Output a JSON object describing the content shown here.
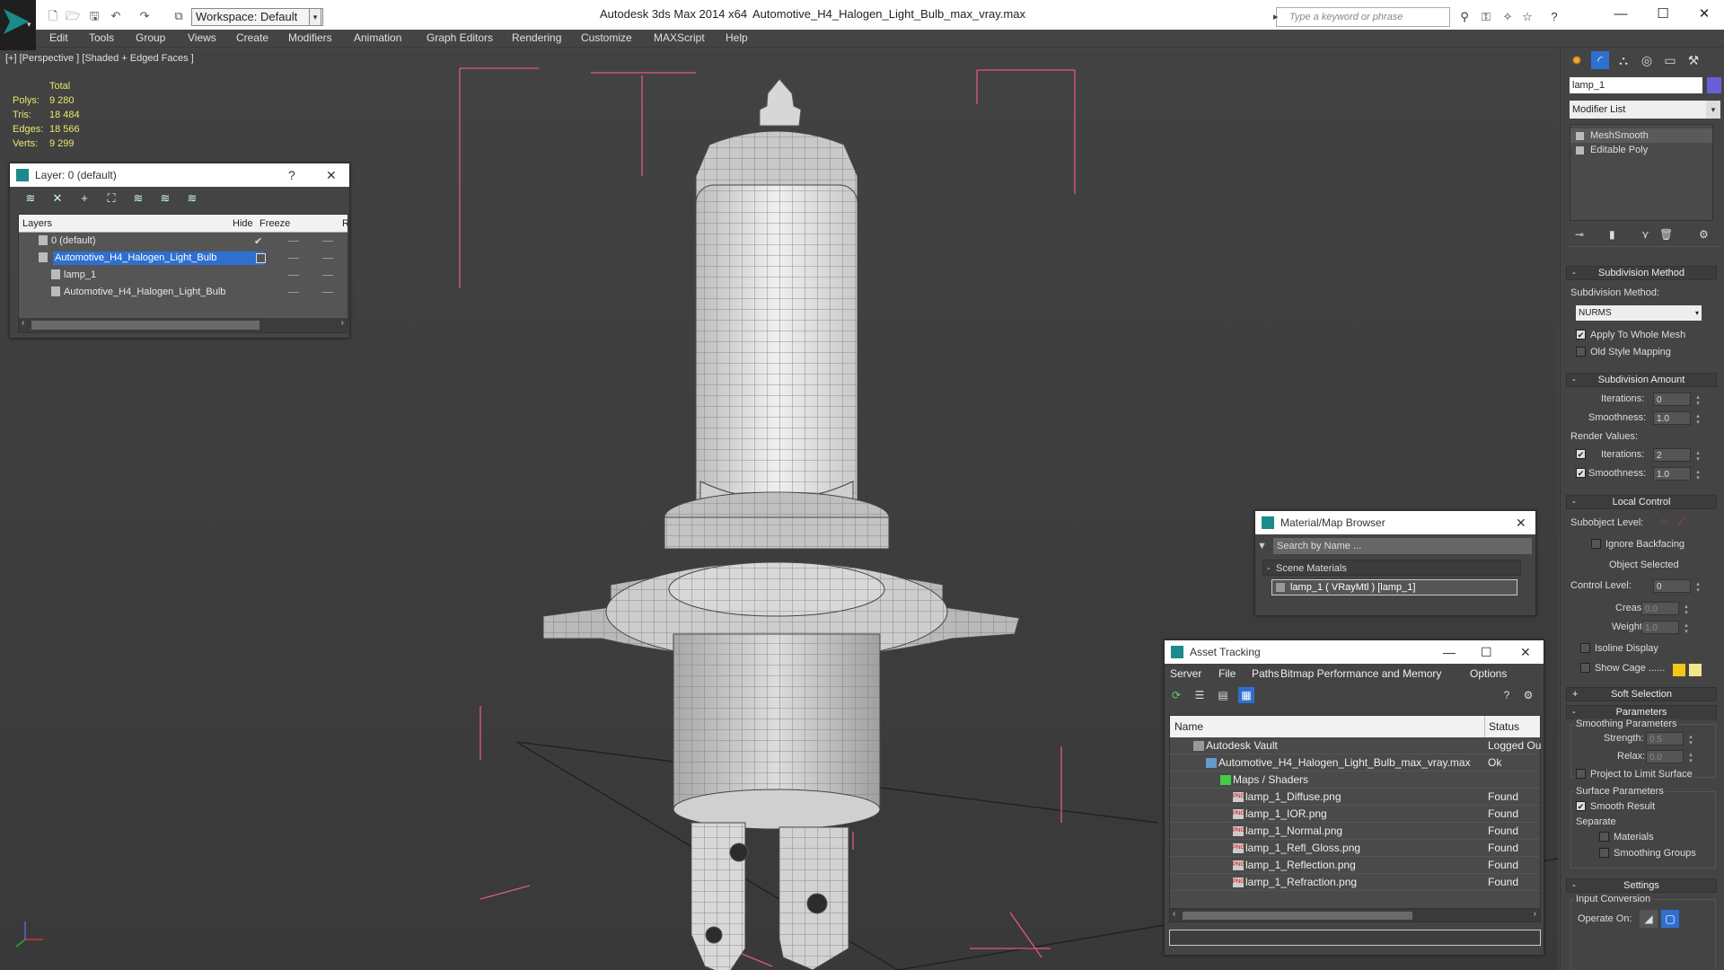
{
  "titlebar": {
    "workspace": "Workspace: Default",
    "app_title": "Autodesk 3ds Max  2014 x64",
    "file_title": "Automotive_H4_Halogen_Light_Bulb_max_vray.max",
    "search_placeholder": "Type a keyword or phrase"
  },
  "menu": [
    "Edit",
    "Tools",
    "Group",
    "Views",
    "Create",
    "Modifiers",
    "Animation",
    "Graph Editors",
    "Rendering",
    "Customize",
    "MAXScript",
    "Help"
  ],
  "viewport": {
    "label": "[+] [Perspective ] [Shaded + Edged Faces ]",
    "stats": {
      "header": "Total",
      "rows": [
        {
          "k": "Polys:",
          "v": "9 280"
        },
        {
          "k": "Tris:",
          "v": "18 484"
        },
        {
          "k": "Edges:",
          "v": "18 566"
        },
        {
          "k": "Verts:",
          "v": "9 299"
        }
      ]
    }
  },
  "layer_window": {
    "title": "Layer: 0 (default)",
    "help": "?",
    "close": "✕",
    "columns": {
      "layers": "Layers",
      "hide": "Hide",
      "freeze": "Freeze",
      "r": "R"
    },
    "rows": [
      {
        "name": "0 (default)",
        "check": "✔"
      },
      {
        "name": "Automotive_H4_Halogen_Light_Bulb",
        "check": ""
      },
      {
        "name": "lamp_1",
        "check": ""
      },
      {
        "name": "Automotive_H4_Halogen_Light_Bulb",
        "check": ""
      }
    ]
  },
  "material_browser": {
    "title": "Material/Map Browser",
    "search_placeholder": "Search by Name ...",
    "section": "Scene Materials",
    "item": "lamp_1  ( VRayMtl )  [lamp_1]"
  },
  "asset_tracking": {
    "title": "Asset Tracking",
    "menu": [
      "Server",
      "File",
      "Paths",
      "Bitmap Performance and Memory",
      "Options"
    ],
    "columns": {
      "name": "Name",
      "status": "Status"
    },
    "rows": [
      {
        "name": "Autodesk Vault",
        "status": "Logged Ou"
      },
      {
        "name": "Automotive_H4_Halogen_Light_Bulb_max_vray.max",
        "status": "Ok"
      },
      {
        "name": "Maps / Shaders",
        "status": ""
      },
      {
        "name": "lamp_1_Diffuse.png",
        "status": "Found"
      },
      {
        "name": "lamp_1_IOR.png",
        "status": "Found"
      },
      {
        "name": "lamp_1_Normal.png",
        "status": "Found"
      },
      {
        "name": "lamp_1_Refl_Gloss.png",
        "status": "Found"
      },
      {
        "name": "lamp_1_Reflection.png",
        "status": "Found"
      },
      {
        "name": "lamp_1_Refraction.png",
        "status": "Found"
      }
    ]
  },
  "command_panel": {
    "object_name": "lamp_1",
    "object_color": "#6a5fd8",
    "modifier_list": "Modifier List",
    "stack": [
      "MeshSmooth",
      "Editable Poly"
    ],
    "subdivision_method": {
      "title": "Subdivision Method",
      "label": "Subdivision Method:",
      "value": "NURMS",
      "apply_whole": "Apply To Whole Mesh",
      "old_style": "Old Style Mapping"
    },
    "subdivision_amount": {
      "title": "Subdivision Amount",
      "iterations_label": "Iterations:",
      "iterations": "0",
      "smoothness_label": "Smoothness:",
      "smoothness": "1.0",
      "render_values": "Render Values:",
      "r_iterations_label": "Iterations:",
      "r_iterations": "2",
      "r_smoothness_label": "Smoothness:",
      "r_smoothness": "1.0"
    },
    "local_control": {
      "title": "Local Control",
      "subobject": "Subobject Level:",
      "ignore_backfacing": "Ignore Backfacing",
      "object_selected": "Object Selected",
      "control_level_label": "Control Level:",
      "control_level": "0",
      "crease_label": "Crease:",
      "crease": "0.0",
      "weight_label": "Weight:",
      "weight": "1.0",
      "isoline": "Isoline Display",
      "show_cage": "Show Cage ......"
    },
    "soft_selection": "Soft Selection",
    "parameters": {
      "title": "Parameters",
      "smoothing": "Smoothing Parameters",
      "strength_label": "Strength:",
      "strength": "0.5",
      "relax_label": "Relax:",
      "relax": "0.0",
      "project": "Project to Limit Surface",
      "surface": "Surface Parameters",
      "smooth_result": "Smooth Result",
      "separate": "Separate",
      "materials": "Materials",
      "smoothing_groups": "Smoothing Groups"
    },
    "settings": {
      "title": "Settings",
      "input_conversion": "Input Conversion",
      "operate_on": "Operate On:"
    }
  },
  "colors": {
    "selection": "#2f6fcf",
    "stats": "#e8e870",
    "cage1": "#f5c518",
    "cage2": "#f0e68c",
    "bbox": "#e05a7a"
  }
}
